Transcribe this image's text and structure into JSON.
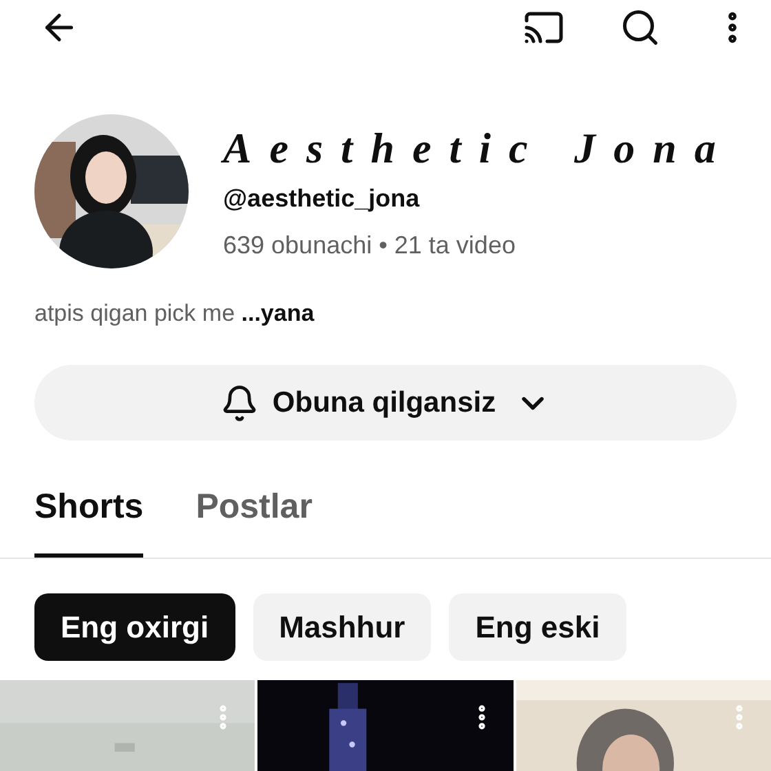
{
  "channel": {
    "name": "Aesthetic Jona",
    "handle": "@aesthetic_jona",
    "stats": "639 obunachi • 21 ta video",
    "bio": "atpis qigan pick me **...yana**"
  },
  "subscribe_button": {
    "label": "Obuna qilgansiz"
  },
  "tabs": [
    {
      "label": "Shorts",
      "selected": true
    },
    {
      "label": "Postlar",
      "selected": false
    }
  ],
  "filters": [
    {
      "label": "Eng oxirgi",
      "selected": true
    },
    {
      "label": "Mashhur",
      "selected": false
    },
    {
      "label": "Eng eski",
      "selected": false
    }
  ]
}
